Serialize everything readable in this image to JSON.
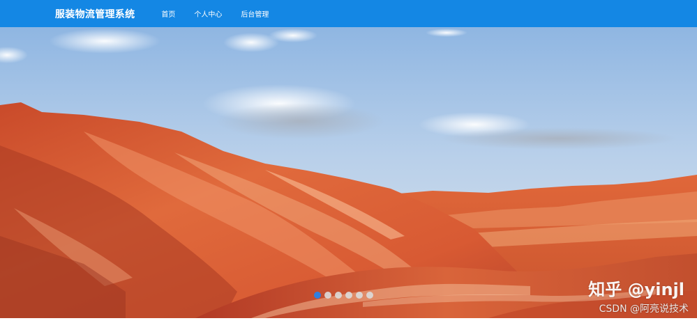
{
  "colors": {
    "brand": "#1487e4",
    "indicator_active": "#2f7fe0",
    "indicator_inactive": "#dcdcdc"
  },
  "navbar": {
    "brand": "服装物流管理系统",
    "links": [
      {
        "label": "首页"
      },
      {
        "label": "个人中心"
      },
      {
        "label": "后台管理"
      }
    ]
  },
  "carousel": {
    "slide_count": 6,
    "active_index": 0,
    "image_subject": "red-striped-mountains-landscape"
  },
  "watermarks": {
    "zhihu": "知乎 @yinjl",
    "csdn": "CSDN @阿亮说技术"
  }
}
